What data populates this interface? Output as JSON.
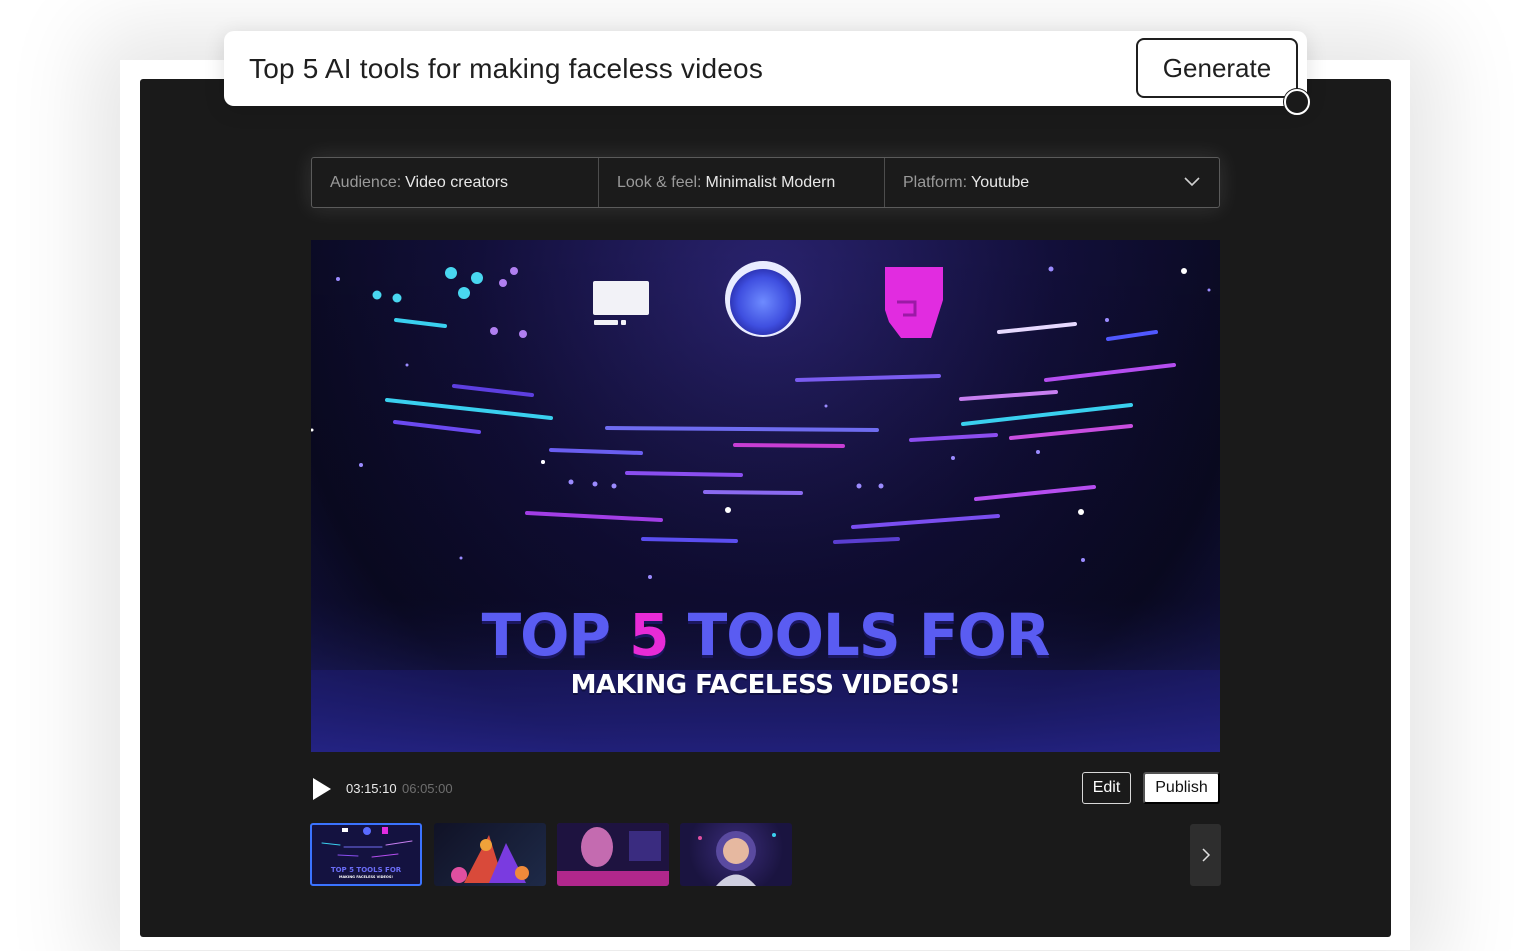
{
  "prompt": {
    "text": "Top 5 AI tools for making faceless videos",
    "generate_label": "Generate"
  },
  "options": {
    "audience_key": "Audience:",
    "audience_value": "Video creators",
    "look_key": "Look & feel:",
    "look_value": "Minimalist Modern",
    "platform_key": "Platform:",
    "platform_value": "Youtube",
    "dropdown_icon": "chevron-down-icon"
  },
  "video": {
    "title_part1": "TOP",
    "title_highlight": "5",
    "title_part2": "TOOLS FOR",
    "subtitle": "MAKING FACELESS VIDEOS!",
    "colors": {
      "title": "#5a5cf2",
      "highlight": "#e82bd6",
      "subtitle": "#ffffff"
    }
  },
  "player": {
    "current_time": "03:15:10",
    "total_time": "06:05:00",
    "play_icon": "play-icon",
    "edit_label": "Edit",
    "publish_label": "Publish"
  },
  "thumbnails": {
    "items": [
      {
        "caption": "TOP 5 TOOLS FOR",
        "caption_sub": "MAKING FACELESS VIDEOS!",
        "active": true
      },
      {
        "caption": "",
        "active": false
      },
      {
        "caption": "",
        "active": false
      },
      {
        "caption": "",
        "active": false
      }
    ],
    "next_icon": "chevron-right-icon",
    "accent": "#3b73ff"
  }
}
